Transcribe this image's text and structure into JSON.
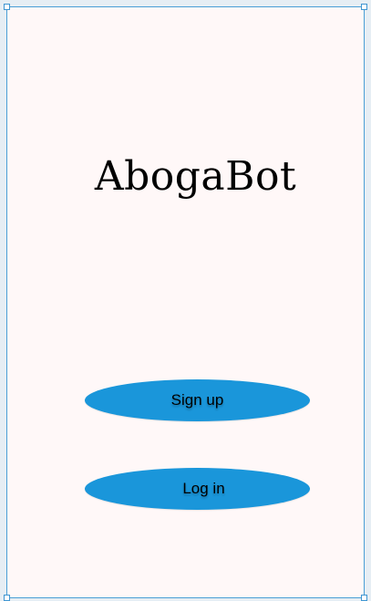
{
  "app": {
    "title": "AbogaBot"
  },
  "actions": {
    "signup_label": "Sign up",
    "login_label": "Log in"
  },
  "colors": {
    "background": "#fff8f8",
    "button": "#1a96da",
    "selection_border": "#4a9fd6",
    "text": "#000000"
  }
}
